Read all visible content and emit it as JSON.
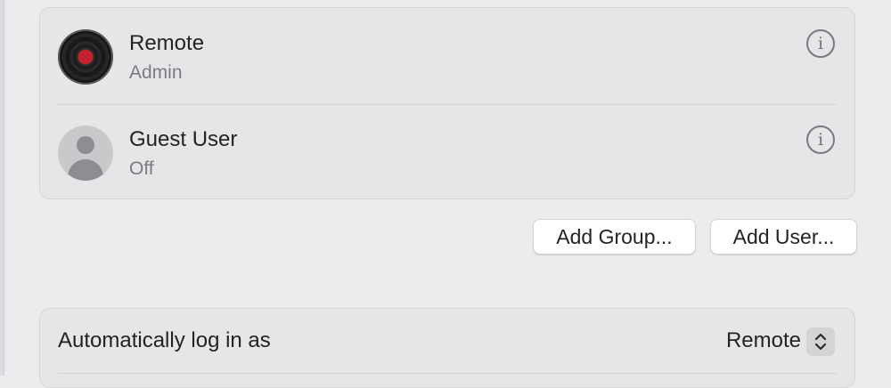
{
  "users": [
    {
      "name": "Remote",
      "role": "Admin",
      "avatar": "vinyl-record-avatar"
    },
    {
      "name": "Guest User",
      "role": "Off",
      "avatar": "person-silhouette-avatar"
    }
  ],
  "info_glyph": "i",
  "buttons": {
    "add_group": "Add Group...",
    "add_user": "Add User..."
  },
  "auto_login": {
    "label": "Automatically log in as",
    "value": "Remote"
  },
  "colors": {
    "background": "#ececee",
    "panel": "#e6e6e8",
    "secondary_text": "#7c7c80",
    "record_label": "#c0232a"
  }
}
